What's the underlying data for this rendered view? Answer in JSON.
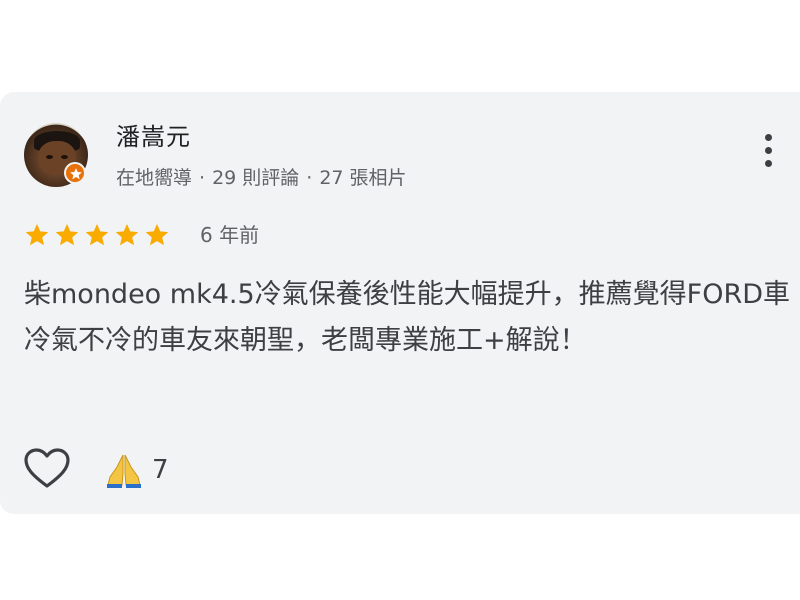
{
  "reviewer": {
    "name": "潘嵩元",
    "badge": "在地嚮導",
    "reviews": "29 則評論",
    "photos": "27 張相片",
    "separator": "·"
  },
  "rating": {
    "stars": 5,
    "max_stars": 5,
    "time": "6 年前",
    "star_color": "#f9ab00"
  },
  "review": {
    "text": "柴mondeo mk4.5冷氣保養後性能大幅提升，推薦覺得FORD車冷氣不冷的車友來朝聖，老闆專業施工+解說！"
  },
  "actions": {
    "like_icon": "heart-outline-icon",
    "reaction_icon": "folded-hands-icon",
    "reaction_count": "7"
  },
  "colors": {
    "card_background": "#f1f3f4",
    "local_guide_badge": "#e8710a",
    "primary_text": "#202124",
    "secondary_text": "#5f6368"
  }
}
